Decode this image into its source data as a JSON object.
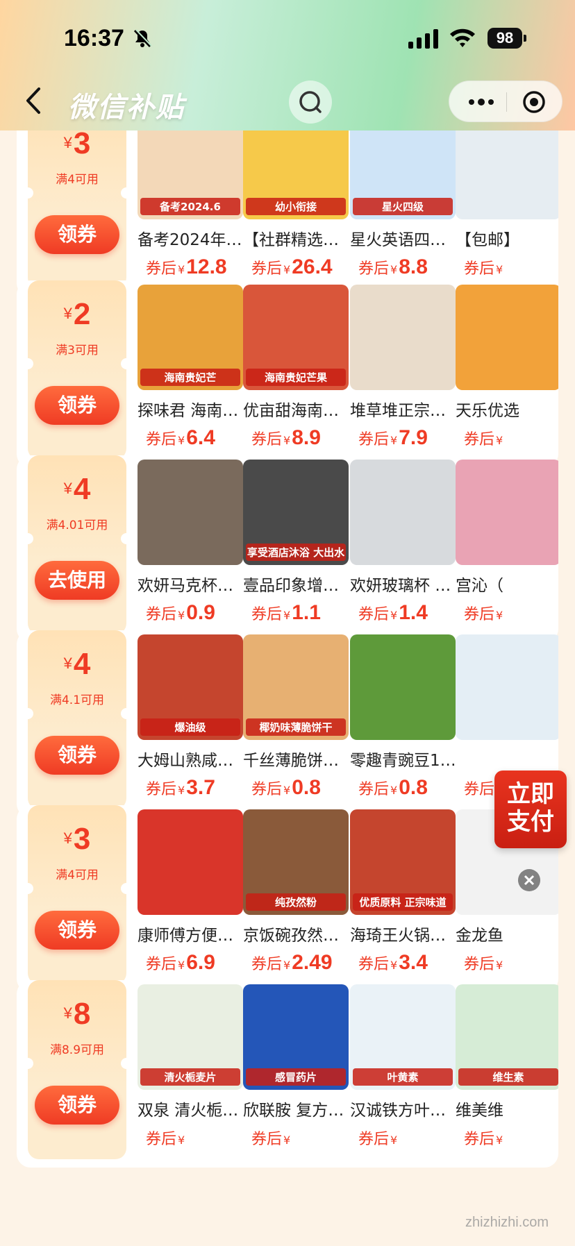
{
  "status_bar": {
    "time": "16:37",
    "battery": "98"
  },
  "nav": {
    "title": "微信补贴"
  },
  "coupon_rows": [
    {
      "amount": "3",
      "condition": "满4可用",
      "button": "领券",
      "products": [
        {
          "name": "备考2024年6…",
          "price_label": "券后",
          "currency": "¥",
          "price": "12.8",
          "img_text": "备考2024.6",
          "img_color": "#f3d8b8"
        },
        {
          "name": "【社群精选】…",
          "price_label": "券后",
          "currency": "¥",
          "price": "26.4",
          "img_text": "幼小衔接",
          "img_color": "#f6c94a"
        },
        {
          "name": "星火英语四级…",
          "price_label": "券后",
          "currency": "¥",
          "price": "8.8",
          "img_text": "星火四级",
          "img_color": "#cfe4f7"
        },
        {
          "name": "【包邮】",
          "price_label": "券后",
          "currency": "¥",
          "price": "",
          "img_text": "",
          "img_color": "#e6edf2"
        }
      ]
    },
    {
      "amount": "2",
      "condition": "满3可用",
      "button": "领券",
      "products": [
        {
          "name": "探味君 海南…",
          "price_label": "券后",
          "currency": "¥",
          "price": "6.4",
          "img_text": "海南贵妃芒",
          "img_color": "#e8a23a"
        },
        {
          "name": "优亩甜海南贵…",
          "price_label": "券后",
          "currency": "¥",
          "price": "8.9",
          "img_text": "海南贵妃芒果",
          "img_color": "#d9563a"
        },
        {
          "name": "堆草堆正宗高…",
          "price_label": "券后",
          "currency": "¥",
          "price": "7.9",
          "img_text": "",
          "img_color": "#e9dccb"
        },
        {
          "name": "天乐优选",
          "price_label": "券后",
          "currency": "¥",
          "price": "",
          "img_text": "",
          "img_color": "#f2a23a"
        }
      ]
    },
    {
      "amount": "4",
      "condition": "满4.01可用",
      "button": "去使用",
      "products": [
        {
          "name": "欢妍马克杯带…",
          "price_label": "券后",
          "currency": "¥",
          "price": "0.9",
          "img_text": "",
          "img_color": "#7a6a5c"
        },
        {
          "name": "壹品印象增压…",
          "price_label": "券后",
          "currency": "¥",
          "price": "1.1",
          "img_text": "享受酒店沐浴 大出水",
          "img_color": "#4a4a4a"
        },
        {
          "name": "欢妍玻璃杯 …",
          "price_label": "券后",
          "currency": "¥",
          "price": "1.4",
          "img_text": "",
          "img_color": "#d7dadd"
        },
        {
          "name": "宫沁（",
          "price_label": "券后",
          "currency": "¥",
          "price": "",
          "img_text": "",
          "img_color": "#e9a3b4"
        }
      ]
    },
    {
      "amount": "4",
      "condition": "满4.1可用",
      "button": "领券",
      "products": [
        {
          "name": "大姆山熟咸鸭…",
          "price_label": "券后",
          "currency": "¥",
          "price": "3.7",
          "img_text": "爆油级",
          "img_color": "#c5452e"
        },
        {
          "name": "千丝薄脆饼干…",
          "price_label": "券后",
          "currency": "¥",
          "price": "0.8",
          "img_text": "椰奶味薄脆饼干",
          "img_color": "#e7b072"
        },
        {
          "name": "零趣青豌豆10…",
          "price_label": "券后",
          "currency": "¥",
          "price": "0.8",
          "img_text": "",
          "img_color": "#5e9a3a"
        },
        {
          "name": "",
          "price_label": "券后",
          "currency": "¥",
          "price": "",
          "img_text": "",
          "img_color": "#e4eef5"
        }
      ]
    },
    {
      "amount": "3",
      "condition": "满4可用",
      "button": "领券",
      "products": [
        {
          "name": "康师傅方便面…",
          "price_label": "券后",
          "currency": "¥",
          "price": "6.9",
          "img_text": "",
          "img_color": "#d9352a"
        },
        {
          "name": "京饭碗孜然粉…",
          "price_label": "券后",
          "currency": "¥",
          "price": "2.49",
          "img_text": "纯孜然粉",
          "img_color": "#8a5a3a"
        },
        {
          "name": "海琦王火锅底…",
          "price_label": "券后",
          "currency": "¥",
          "price": "3.4",
          "img_text": "优质原料 正宗味道",
          "img_color": "#c5452e"
        },
        {
          "name": "金龙鱼",
          "price_label": "券后",
          "currency": "¥",
          "price": "",
          "img_text": "",
          "img_color": "#f2f2f2"
        }
      ]
    },
    {
      "amount": "8",
      "condition": "满8.9可用",
      "button": "领券",
      "products": [
        {
          "name": "双泉 清火栀…",
          "price_label": "券后",
          "currency": "¥",
          "price": "",
          "img_text": "清火栀麦片",
          "img_color": "#e9efe2"
        },
        {
          "name": "欣联胺 复方…",
          "price_label": "券后",
          "currency": "¥",
          "price": "",
          "img_text": "感冒药片",
          "img_color": "#2456b8"
        },
        {
          "name": "汉诚铁方叶黄…",
          "price_label": "券后",
          "currency": "¥",
          "price": "",
          "img_text": "叶黄素",
          "img_color": "#eaf2f7"
        },
        {
          "name": "维美维",
          "price_label": "券后",
          "currency": "¥",
          "price": "",
          "img_text": "维生素",
          "img_color": "#d6ecd6"
        }
      ]
    }
  ],
  "float_button": {
    "label": "立即支付"
  },
  "watermark": "zhizhizhi.com",
  "colors": {
    "accent": "#ef3b24",
    "coupon_bg": "#fdeccf",
    "page_bg": "#fdf3e7"
  }
}
